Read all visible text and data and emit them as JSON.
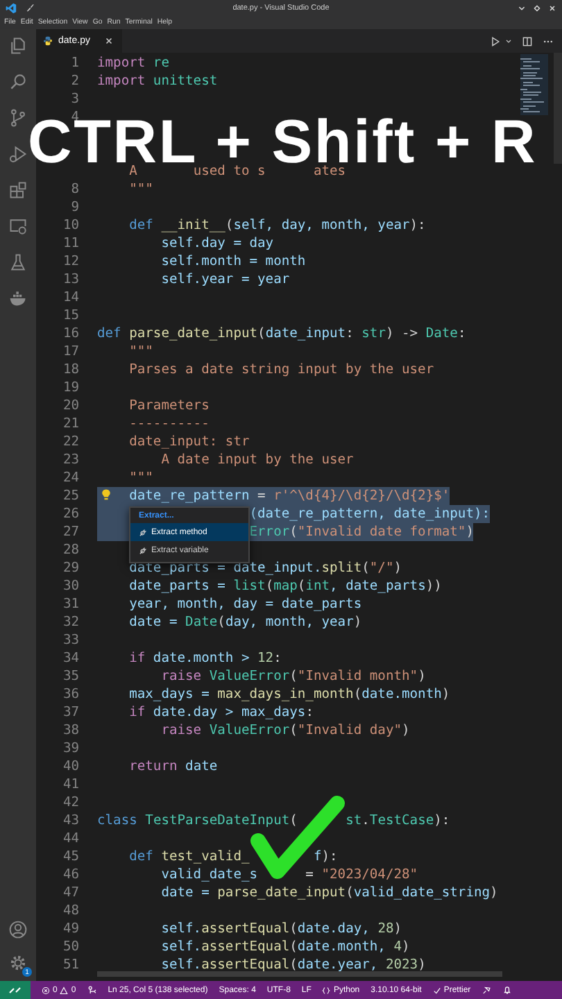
{
  "window": {
    "title": "date.py - Visual Studio Code"
  },
  "menu": [
    "File",
    "Edit",
    "Selection",
    "View",
    "Go",
    "Run",
    "Terminal",
    "Help"
  ],
  "tabs": [
    {
      "label": "date.py",
      "selected": true
    }
  ],
  "editor": {
    "lines": [
      {
        "number": "1",
        "selected": false,
        "tokens": [
          {
            "text": "import",
            "kind": "keyword"
          },
          {
            "text": " re",
            "kind": "type"
          }
        ]
      },
      {
        "number": "2",
        "selected": false,
        "tokens": [
          {
            "text": "import",
            "kind": "keyword"
          },
          {
            "text": " unittest",
            "kind": "type"
          }
        ]
      },
      {
        "number": "3",
        "selected": false
      },
      {
        "number": "4",
        "selected": false
      },
      {
        "selected": false
      },
      {
        "selected": false
      },
      {
        "selected": false,
        "tokens": [
          {
            "text": "    A",
            "kind": "string"
          },
          {
            "text": "       used to s",
            "kind": "string"
          },
          {
            "text": "      ates",
            "kind": "string"
          }
        ]
      },
      {
        "number": "8",
        "selected": false,
        "tokens": [
          {
            "text": "    \"\"\"",
            "kind": "string"
          }
        ]
      },
      {
        "number": "9",
        "selected": false
      },
      {
        "number": "10",
        "selected": false,
        "tokens": [
          {
            "text": "    def",
            "kind": "storage"
          },
          {
            "text": " __init__",
            "kind": "function"
          },
          {
            "text": "(",
            "kind": "plain"
          },
          {
            "text": "self, day, month, year",
            "kind": "variable"
          },
          {
            "text": "):",
            "kind": "plain"
          }
        ]
      },
      {
        "number": "11",
        "selected": false,
        "tokens": [
          {
            "text": "        self.day = day",
            "kind": "variable"
          }
        ]
      },
      {
        "number": "12",
        "selected": false,
        "tokens": [
          {
            "text": "        self.month = month",
            "kind": "variable"
          }
        ]
      },
      {
        "number": "13",
        "selected": false,
        "tokens": [
          {
            "text": "        self.year = year",
            "kind": "variable"
          }
        ]
      },
      {
        "number": "14",
        "selected": false
      },
      {
        "number": "15",
        "selected": false
      },
      {
        "number": "16",
        "selected": false,
        "tokens": [
          {
            "text": "def",
            "kind": "storage"
          },
          {
            "text": " parse_date_input",
            "kind": "function"
          },
          {
            "text": "(",
            "kind": "plain"
          },
          {
            "text": "date_input",
            "kind": "variable"
          },
          {
            "text": ": ",
            "kind": "plain"
          },
          {
            "text": "str",
            "kind": "type"
          },
          {
            "text": ") -> ",
            "kind": "plain"
          },
          {
            "text": "Date",
            "kind": "type"
          },
          {
            "text": ":",
            "kind": "plain"
          }
        ]
      },
      {
        "number": "17",
        "selected": false,
        "tokens": [
          {
            "text": "    \"\"\"",
            "kind": "string"
          }
        ]
      },
      {
        "number": "18",
        "selected": false,
        "tokens": [
          {
            "text": "    Parses a date string input by the user",
            "kind": "string"
          }
        ]
      },
      {
        "number": "19",
        "selected": false
      },
      {
        "number": "20",
        "selected": false,
        "tokens": [
          {
            "text": "    Parameters",
            "kind": "string"
          }
        ]
      },
      {
        "number": "21",
        "selected": false,
        "tokens": [
          {
            "text": "    ----------",
            "kind": "string"
          }
        ]
      },
      {
        "number": "22",
        "selected": false,
        "tokens": [
          {
            "text": "    date_input: str",
            "kind": "string"
          }
        ]
      },
      {
        "number": "23",
        "selected": false,
        "tokens": [
          {
            "text": "        A date input by the user",
            "kind": "string"
          }
        ]
      },
      {
        "number": "24",
        "selected": false,
        "tokens": [
          {
            "text": "    \"\"\"",
            "kind": "string"
          }
        ]
      },
      {
        "number": "25",
        "selected": true,
        "tokens": [
          {
            "text": "    date_re_pattern",
            "kind": "variable"
          },
          {
            "text": " = ",
            "kind": "plain"
          },
          {
            "text": "r'^\\d{4}/\\d{2}/\\d{2}$'",
            "kind": "string"
          }
        ]
      },
      {
        "number": "26",
        "selected": true,
        "tokens": [
          {
            "text": "                   (date_re_pattern, date_input):",
            "kind": "variable"
          }
        ]
      },
      {
        "number": "27",
        "selected": true,
        "tokens": [
          {
            "text": "                   Error",
            "kind": "type"
          },
          {
            "text": "(",
            "kind": "plain"
          },
          {
            "text": "\"Invalid date format\"",
            "kind": "string"
          },
          {
            "text": ")",
            "kind": "plain"
          }
        ]
      },
      {
        "number": "28",
        "selected": false
      },
      {
        "number": "29",
        "selected": false,
        "tokens": [
          {
            "text": "    date_parts = date_input.",
            "kind": "variable"
          },
          {
            "text": "split",
            "kind": "function"
          },
          {
            "text": "(",
            "kind": "plain"
          },
          {
            "text": "\"/\"",
            "kind": "string"
          },
          {
            "text": ")",
            "kind": "plain"
          }
        ]
      },
      {
        "number": "30",
        "selected": false,
        "tokens": [
          {
            "text": "    date_parts = ",
            "kind": "variable"
          },
          {
            "text": "list",
            "kind": "type"
          },
          {
            "text": "(",
            "kind": "plain"
          },
          {
            "text": "map",
            "kind": "type"
          },
          {
            "text": "(",
            "kind": "plain"
          },
          {
            "text": "int",
            "kind": "type"
          },
          {
            "text": ", date_parts",
            "kind": "variable"
          },
          {
            "text": "))",
            "kind": "plain"
          }
        ]
      },
      {
        "number": "31",
        "selected": false,
        "tokens": [
          {
            "text": "    year, month, day = date_parts",
            "kind": "variable"
          }
        ]
      },
      {
        "number": "32",
        "selected": false,
        "tokens": [
          {
            "text": "    date = ",
            "kind": "variable"
          },
          {
            "text": "Date",
            "kind": "type"
          },
          {
            "text": "(",
            "kind": "plain"
          },
          {
            "text": "day, month, year",
            "kind": "variable"
          },
          {
            "text": ")",
            "kind": "plain"
          }
        ]
      },
      {
        "number": "33",
        "selected": false
      },
      {
        "number": "34",
        "selected": false,
        "tokens": [
          {
            "text": "    if",
            "kind": "keyword"
          },
          {
            "text": " date.month > ",
            "kind": "variable"
          },
          {
            "text": "12",
            "kind": "number"
          },
          {
            "text": ":",
            "kind": "plain"
          }
        ]
      },
      {
        "number": "35",
        "selected": false,
        "tokens": [
          {
            "text": "        raise",
            "kind": "keyword"
          },
          {
            "text": " ValueError",
            "kind": "type"
          },
          {
            "text": "(",
            "kind": "plain"
          },
          {
            "text": "\"Invalid month\"",
            "kind": "string"
          },
          {
            "text": ")",
            "kind": "plain"
          }
        ]
      },
      {
        "number": "36",
        "selected": false,
        "tokens": [
          {
            "text": "    max_days = ",
            "kind": "variable"
          },
          {
            "text": "max_days_in_month",
            "kind": "function"
          },
          {
            "text": "(",
            "kind": "plain"
          },
          {
            "text": "date.month",
            "kind": "variable"
          },
          {
            "text": ")",
            "kind": "plain"
          }
        ]
      },
      {
        "number": "37",
        "selected": false,
        "tokens": [
          {
            "text": "    if",
            "kind": "keyword"
          },
          {
            "text": " date.day > max_days",
            "kind": "variable"
          },
          {
            "text": ":",
            "kind": "plain"
          }
        ]
      },
      {
        "number": "38",
        "selected": false,
        "tokens": [
          {
            "text": "        raise",
            "kind": "keyword"
          },
          {
            "text": " ValueError",
            "kind": "type"
          },
          {
            "text": "(",
            "kind": "plain"
          },
          {
            "text": "\"Invalid day\"",
            "kind": "string"
          },
          {
            "text": ")",
            "kind": "plain"
          }
        ]
      },
      {
        "number": "39",
        "selected": false
      },
      {
        "number": "40",
        "selected": false,
        "tokens": [
          {
            "text": "    return",
            "kind": "keyword"
          },
          {
            "text": " date",
            "kind": "variable"
          }
        ]
      },
      {
        "number": "41",
        "selected": false
      },
      {
        "number": "42",
        "selected": false
      },
      {
        "number": "43",
        "selected": false,
        "tokens": [
          {
            "text": "class",
            "kind": "storage"
          },
          {
            "text": " TestParseDateInput",
            "kind": "type"
          },
          {
            "text": "(",
            "kind": "plain"
          },
          {
            "text": "      st",
            "kind": "type"
          },
          {
            "text": ".",
            "kind": "plain"
          },
          {
            "text": "TestCase",
            "kind": "type"
          },
          {
            "text": "):",
            "kind": "plain"
          }
        ]
      },
      {
        "number": "44",
        "selected": false
      },
      {
        "number": "45",
        "selected": false,
        "tokens": [
          {
            "text": "    def",
            "kind": "storage"
          },
          {
            "text": " test_valid_",
            "kind": "function"
          },
          {
            "text": "        f",
            "kind": "variable"
          },
          {
            "text": "):",
            "kind": "plain"
          }
        ]
      },
      {
        "number": "46",
        "selected": false,
        "tokens": [
          {
            "text": "        valid_date_s",
            "kind": "variable"
          },
          {
            "text": "      = ",
            "kind": "plain"
          },
          {
            "text": "\"2023/04/28\"",
            "kind": "string"
          }
        ]
      },
      {
        "number": "47",
        "selected": false,
        "tokens": [
          {
            "text": "        date = ",
            "kind": "variable"
          },
          {
            "text": "parse_date_input",
            "kind": "function"
          },
          {
            "text": "(",
            "kind": "plain"
          },
          {
            "text": "valid_date_string",
            "kind": "variable"
          },
          {
            "text": ")",
            "kind": "plain"
          }
        ]
      },
      {
        "number": "48",
        "selected": false
      },
      {
        "number": "49",
        "selected": false,
        "tokens": [
          {
            "text": "        self.",
            "kind": "variable"
          },
          {
            "text": "assertEqual",
            "kind": "function"
          },
          {
            "text": "(",
            "kind": "plain"
          },
          {
            "text": "date.day, ",
            "kind": "variable"
          },
          {
            "text": "28",
            "kind": "number"
          },
          {
            "text": ")",
            "kind": "plain"
          }
        ]
      },
      {
        "number": "50",
        "selected": false,
        "tokens": [
          {
            "text": "        self.",
            "kind": "variable"
          },
          {
            "text": "assertEqual",
            "kind": "function"
          },
          {
            "text": "(",
            "kind": "plain"
          },
          {
            "text": "date.month, ",
            "kind": "variable"
          },
          {
            "text": "4",
            "kind": "number"
          },
          {
            "text": ")",
            "kind": "plain"
          }
        ]
      },
      {
        "number": "51",
        "selected": false,
        "tokens": [
          {
            "text": "        self.",
            "kind": "variable"
          },
          {
            "text": "assertEqual",
            "kind": "function"
          },
          {
            "text": "(",
            "kind": "plain"
          },
          {
            "text": "date.year, ",
            "kind": "variable"
          },
          {
            "text": "2023",
            "kind": "number"
          },
          {
            "text": ")",
            "kind": "plain"
          }
        ]
      }
    ]
  },
  "code_action_menu": {
    "header": "Extract...",
    "items": [
      {
        "label": "Extract method",
        "selected": true
      },
      {
        "label": "Extract variable",
        "selected": false
      }
    ]
  },
  "overlay": {
    "caption": "CTRL + Shift + R"
  },
  "settings_badge": "1",
  "status_bar": {
    "errors": "0",
    "warnings": "0",
    "cursor": "Ln 25, Col 5 (138 selected)",
    "indentation": "Spaces: 4",
    "encoding": "UTF-8",
    "line_ending": "LF",
    "language": "Python",
    "interpreter": "3.10.10 64-bit",
    "formatter": "Prettier"
  }
}
